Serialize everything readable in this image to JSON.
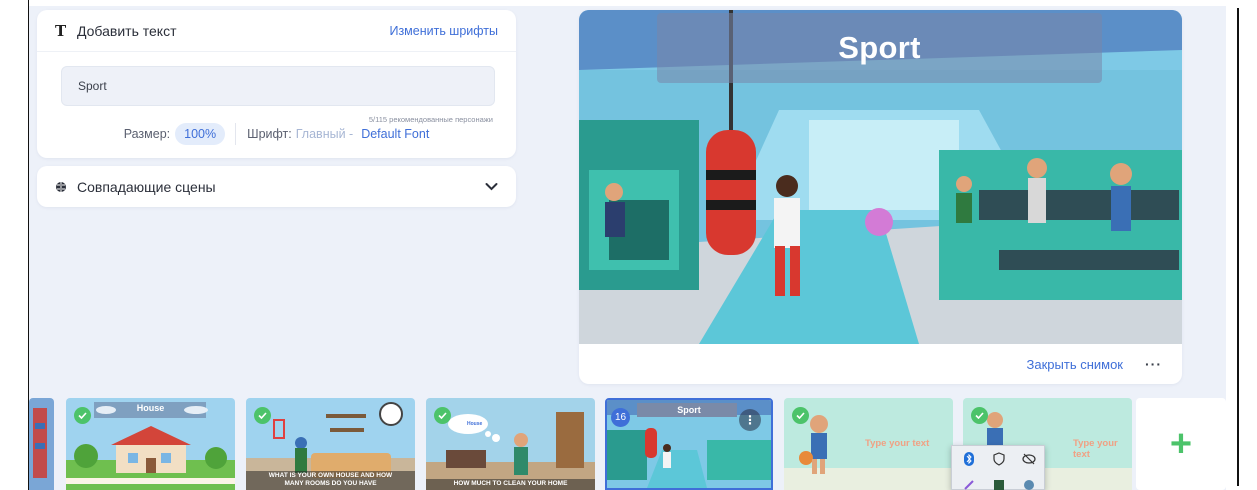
{
  "text_card": {
    "title": "Добавить текст",
    "change_fonts": "Изменить шрифты",
    "input_value": "Sport",
    "char_count": "5/115 рекомендованные персонажи",
    "size_label": "Размер:",
    "size_value": "100%",
    "font_label": "Шрифт:",
    "font_main": "Главный -",
    "font_name": "Default Font"
  },
  "scenes_card": {
    "title": "Совпадающие сцены"
  },
  "preview": {
    "title": "Sport",
    "close_label": "Закрыть снимок",
    "more": "···"
  },
  "timeline": {
    "house_title": "House",
    "caption_room": "WHAT IS YOUR OWN HOUSE AND HOW MANY ROOMS DO YOU HAVE",
    "caption_clean": "HOW MUCH TO CLEAN YOUR HOME",
    "speech_text": "House",
    "active_number": "16",
    "active_title": "Sport",
    "kebab": "⋮",
    "placeholder1": "Type your text",
    "placeholder2": "Type your text",
    "add": "+"
  },
  "colors": {
    "accent": "#3f6fd8",
    "success": "#4cc36a",
    "background": "#edf1f9"
  },
  "icons": [
    "text-icon",
    "brain-icon",
    "chevron-down-icon",
    "check-icon",
    "plus-icon",
    "bluetooth-icon",
    "shield-icon",
    "eye-off-icon"
  ]
}
